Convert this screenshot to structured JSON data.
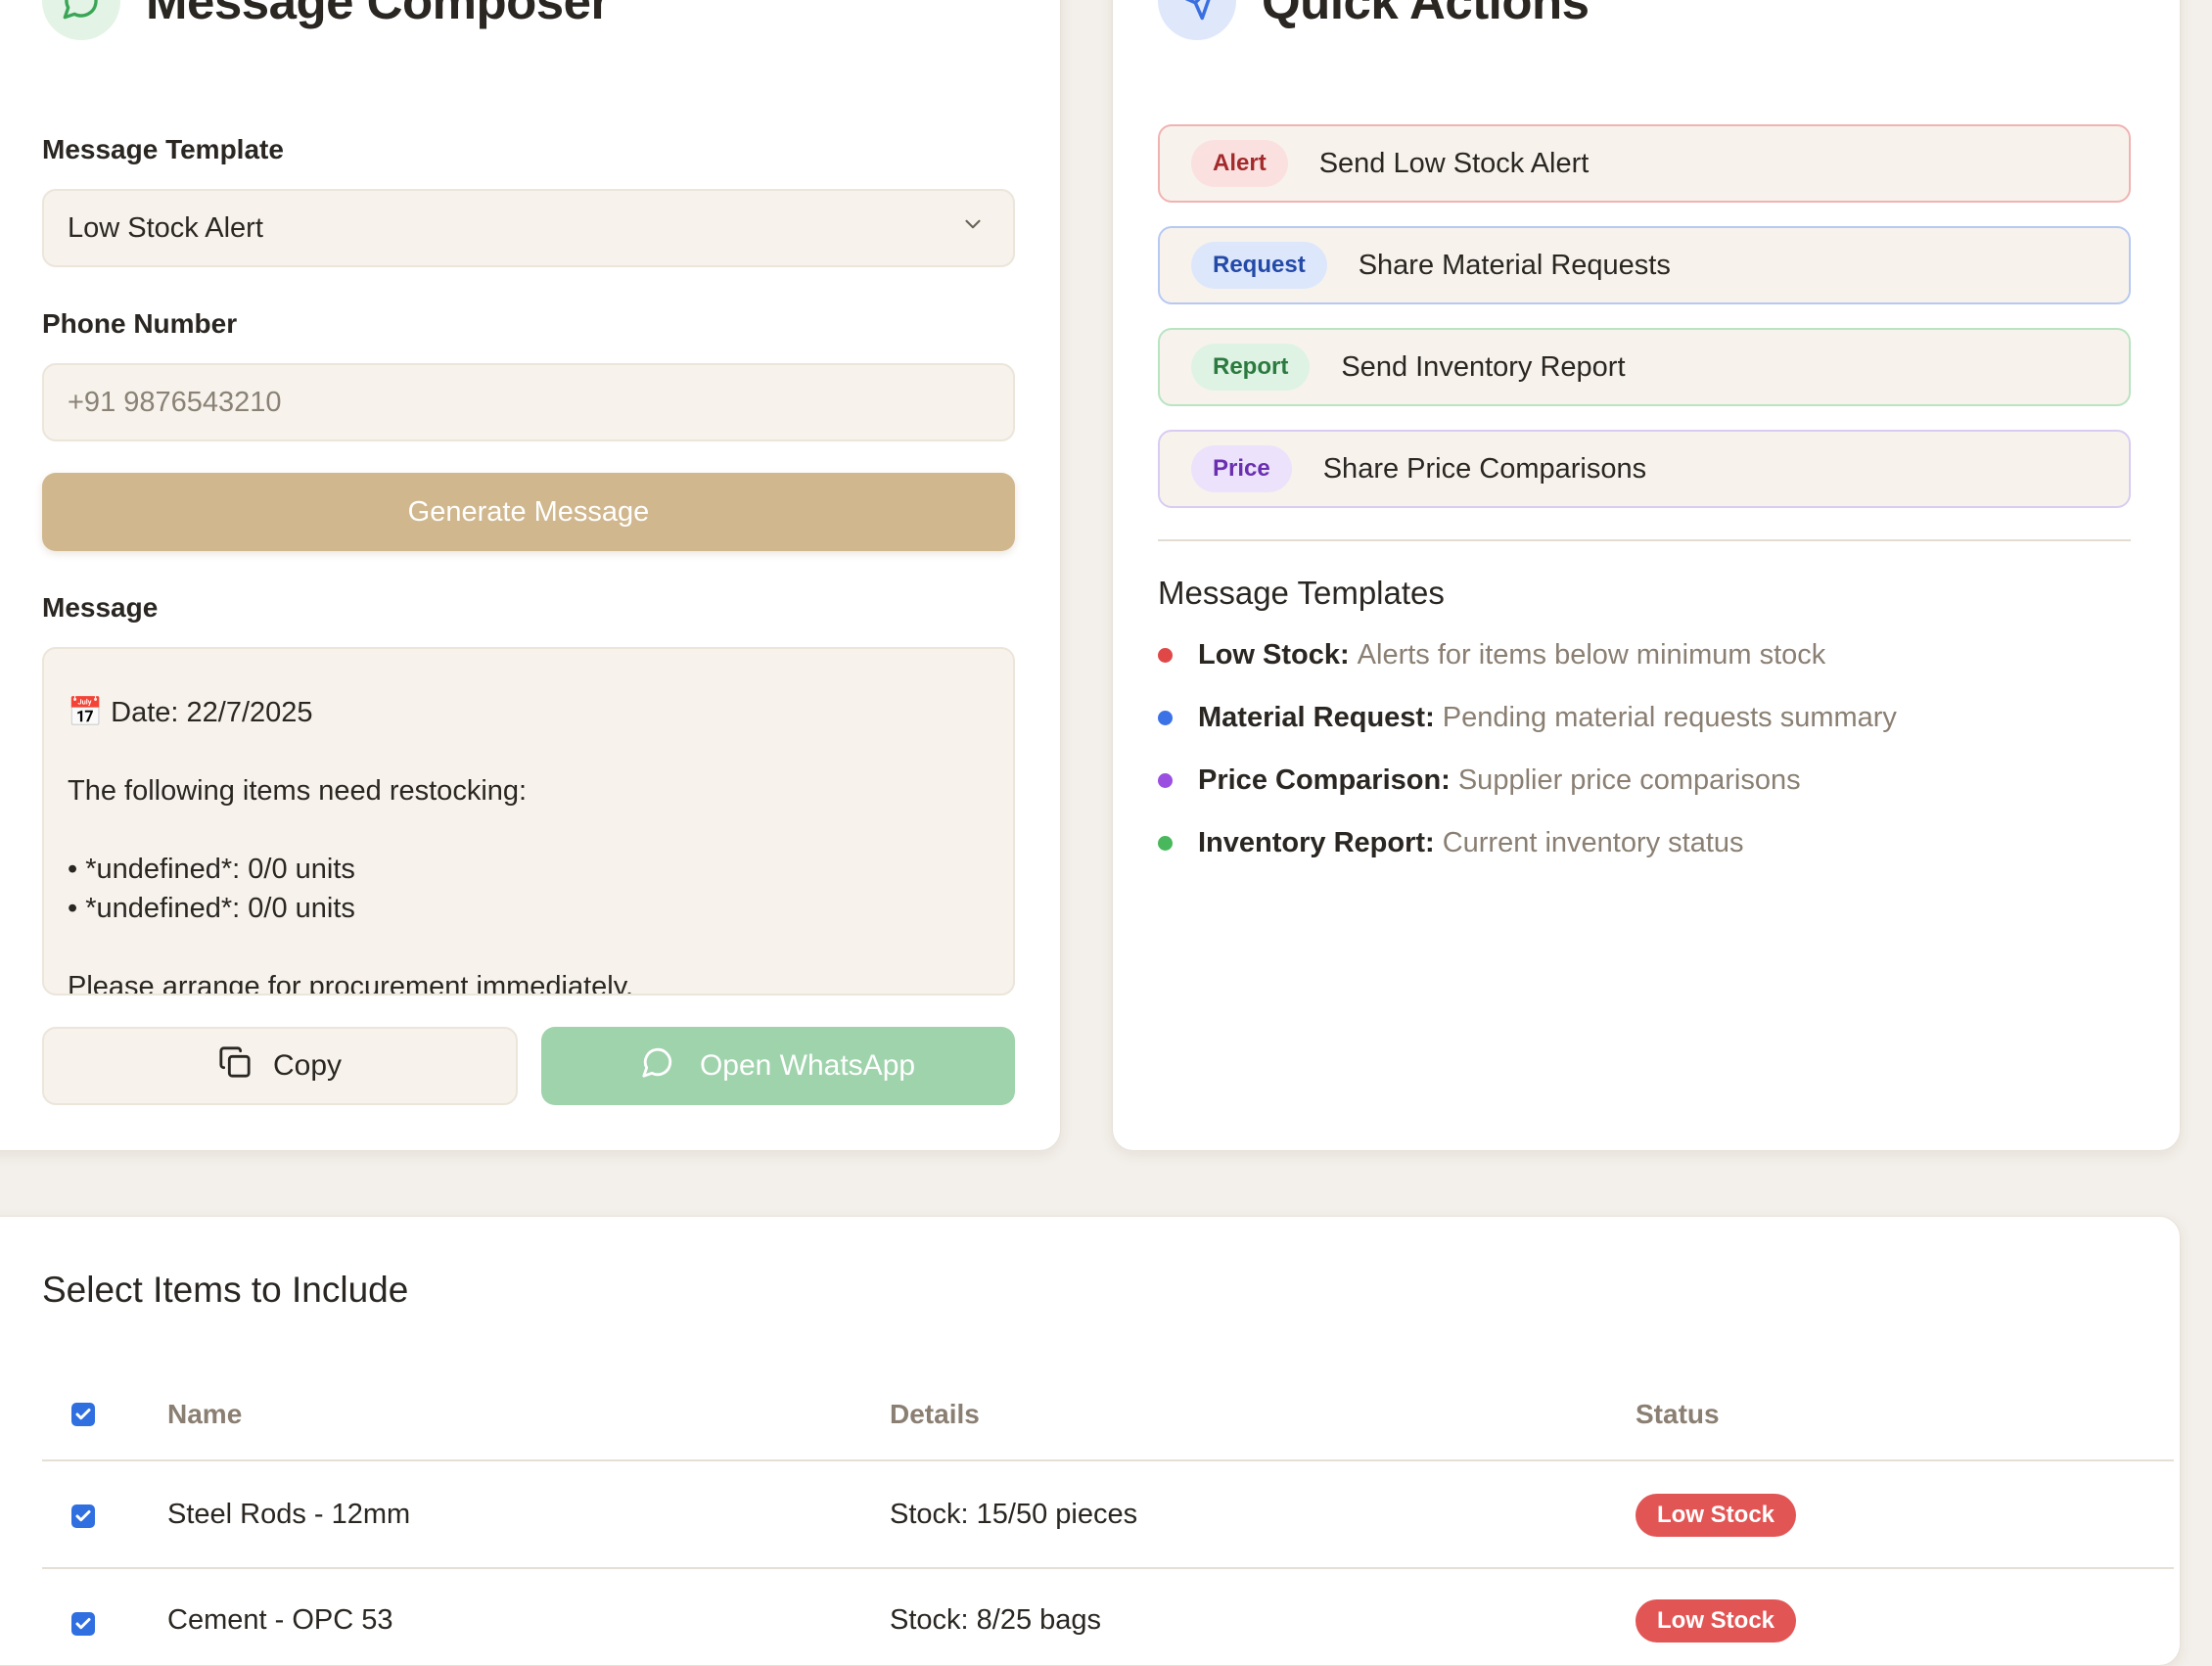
{
  "composer": {
    "title": "Message Composer",
    "icon": "chat-bubble-icon",
    "template_label": "Message Template",
    "template_value": "Low Stock Alert",
    "phone_label": "Phone Number",
    "phone_placeholder": "+91 9876543210",
    "generate_button": "Generate Message",
    "message_label": "Message",
    "message_lines": [
      "📅 Date: 22/7/2025",
      "The following items need restocking:",
      "• *undefined*: 0/0 units",
      "• *undefined*: 0/0 units",
      "Please arrange for procurement immediately."
    ],
    "copy_button": "Copy",
    "whatsapp_button": "Open WhatsApp"
  },
  "quick_actions": {
    "title": "Quick Actions",
    "icon": "send-icon",
    "actions": [
      {
        "badge": "Alert",
        "label": "Send Low Stock Alert"
      },
      {
        "badge": "Request",
        "label": "Share Material Requests"
      },
      {
        "badge": "Report",
        "label": "Send Inventory Report"
      },
      {
        "badge": "Price",
        "label": "Share Price Comparisons"
      }
    ],
    "templates_title": "Message Templates",
    "templates": [
      {
        "key": "Low Stock:",
        "desc": "Alerts for items below minimum stock",
        "color": "#e04848"
      },
      {
        "key": "Material Request:",
        "desc": "Pending material requests summary",
        "color": "#3b73e6"
      },
      {
        "key": "Price Comparison:",
        "desc": "Supplier price comparisons",
        "color": "#9b4fe0"
      },
      {
        "key": "Inventory Report:",
        "desc": "Current inventory status",
        "color": "#49b85d"
      }
    ]
  },
  "items": {
    "title": "Select Items to Include",
    "columns": [
      "Name",
      "Details",
      "Status"
    ],
    "rows": [
      {
        "name": "Steel Rods - 12mm",
        "details": "Stock: 15/50 pieces",
        "status": "Low Stock"
      },
      {
        "name": "Cement - OPC 53",
        "details": "Stock: 8/25 bags",
        "status": "Low Stock"
      }
    ]
  },
  "colors": {
    "accent_tan": "#d0b78e",
    "whatsapp_green": "#9fd3ac",
    "low_stock_red": "#e25555",
    "checkbox_blue": "#2f6fe0"
  }
}
